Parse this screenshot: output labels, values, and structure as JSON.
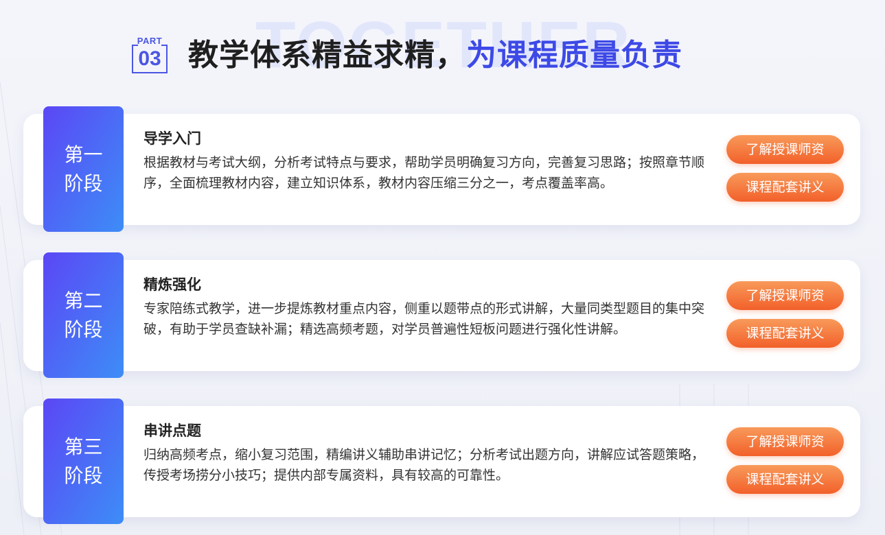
{
  "header": {
    "part_label": "PART",
    "part_number": "03",
    "title_main": "教学体系精益求精，",
    "title_accent": "为课程质量负责",
    "watermark": "TOGETHER"
  },
  "colors": {
    "accent": "#3d49e6",
    "badge_gradient_start": "#5b47f5",
    "badge_gradient_end": "#3d8df7",
    "button_gradient_start": "#f89a5a",
    "button_gradient_end": "#f2602a"
  },
  "stages": [
    {
      "badge_line1": "第一",
      "badge_line2": "阶段",
      "title": "导学入门",
      "description": "根据教材与考试大纲，分析考试特点与要求，帮助学员明确复习方向，完善复习思路；按照章节顺序，全面梳理教材内容，建立知识体系，教材内容压缩三分之一，考点覆盖率高。",
      "button_teachers": "了解授课师资",
      "button_materials": "课程配套讲义"
    },
    {
      "badge_line1": "第二",
      "badge_line2": "阶段",
      "title": "精炼强化",
      "description": "专家陪练式教学，进一步提炼教材重点内容，侧重以题带点的形式讲解，大量同类型题目的集中突破，有助于学员查缺补漏；精选高频考题，对学员普遍性短板问题进行强化性讲解。",
      "button_teachers": "了解授课师资",
      "button_materials": "课程配套讲义"
    },
    {
      "badge_line1": "第三",
      "badge_line2": "阶段",
      "title": "串讲点题",
      "description": "归纳高频考点，缩小复习范围，精编讲义辅助串讲记忆；分析考试出题方向，讲解应试答题策略，传授考场捞分小技巧；提供内部专属资料，具有较高的可靠性。",
      "button_teachers": "了解授课师资",
      "button_materials": "课程配套讲义"
    }
  ]
}
